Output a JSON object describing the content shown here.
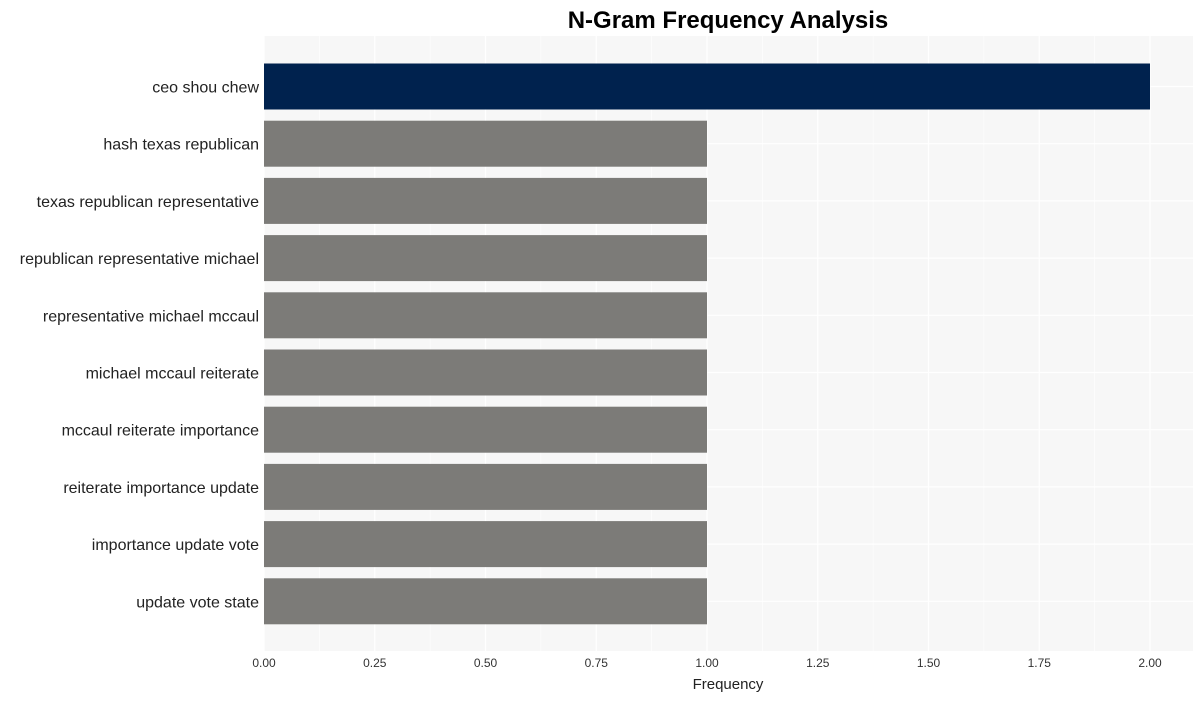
{
  "chart_data": {
    "type": "bar",
    "orientation": "horizontal",
    "title": "N-Gram Frequency Analysis",
    "xlabel": "Frequency",
    "ylabel": "",
    "xlim": [
      0,
      2.1
    ],
    "xticks": [
      0,
      0.25,
      0.5,
      0.75,
      1.0,
      1.25,
      1.5,
      1.75,
      2.0
    ],
    "xtick_labels": [
      "0.00",
      "0.25",
      "0.50",
      "0.75",
      "1.00",
      "1.25",
      "1.50",
      "1.75",
      "2.00"
    ],
    "grid": true,
    "legend": "none",
    "categories": [
      "ceo shou chew",
      "hash texas republican",
      "texas republican representative",
      "republican representative michael",
      "representative michael mccaul",
      "michael mccaul reiterate",
      "mccaul reiterate importance",
      "reiterate importance update",
      "importance update vote",
      "update vote state"
    ],
    "values": [
      2,
      1,
      1,
      1,
      1,
      1,
      1,
      1,
      1,
      1
    ],
    "colors": {
      "highlight": "#00224e",
      "default": "#7c7b78",
      "panel_background": "#f7f7f7",
      "gridline": "#ffffff"
    }
  }
}
